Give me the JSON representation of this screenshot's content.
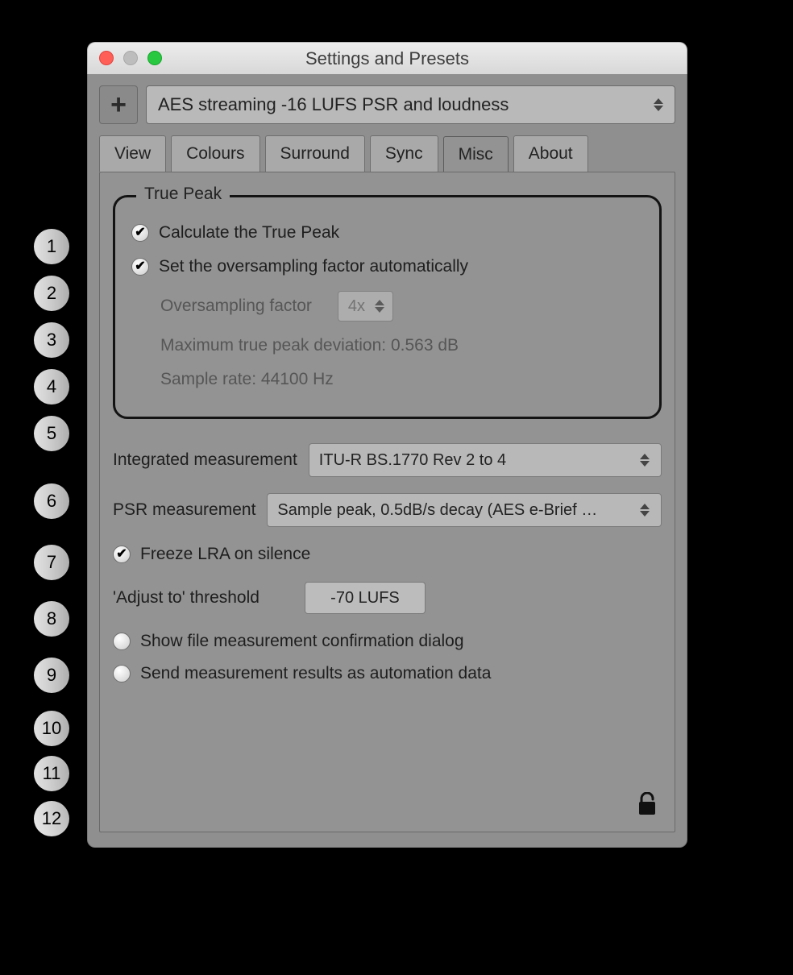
{
  "window": {
    "title": "Settings and Presets"
  },
  "preset": {
    "selected": "AES streaming -16 LUFS PSR and loudness"
  },
  "tabs": [
    {
      "label": "View"
    },
    {
      "label": "Colours"
    },
    {
      "label": "Surround"
    },
    {
      "label": "Sync"
    },
    {
      "label": "Misc"
    },
    {
      "label": "About"
    }
  ],
  "truepeak": {
    "legend": "True Peak",
    "calc_label": "Calculate the True Peak",
    "auto_os_label": "Set the oversampling factor automatically",
    "os_factor_label": "Oversampling factor",
    "os_factor_value": "4x",
    "max_dev_label": "Maximum true peak deviation: 0.563 dB",
    "samplerate_label": "Sample rate: 44100 Hz"
  },
  "integrated": {
    "label": "Integrated measurement",
    "value": "ITU-R BS.1770 Rev 2 to 4"
  },
  "psr": {
    "label": "PSR measurement",
    "value": "Sample peak, 0.5dB/s decay (AES e-Brief …"
  },
  "freeze_lra": {
    "label": "Freeze LRA on silence"
  },
  "adjust_to": {
    "label": "'Adjust to' threshold",
    "value": "-70 LUFS"
  },
  "show_confirm": {
    "label": "Show file measurement confirmation dialog"
  },
  "send_auto": {
    "label": "Send measurement results as automation data"
  },
  "callouts": [
    "1",
    "2",
    "3",
    "4",
    "5",
    "6",
    "7",
    "8",
    "9",
    "10",
    "11",
    "12"
  ]
}
